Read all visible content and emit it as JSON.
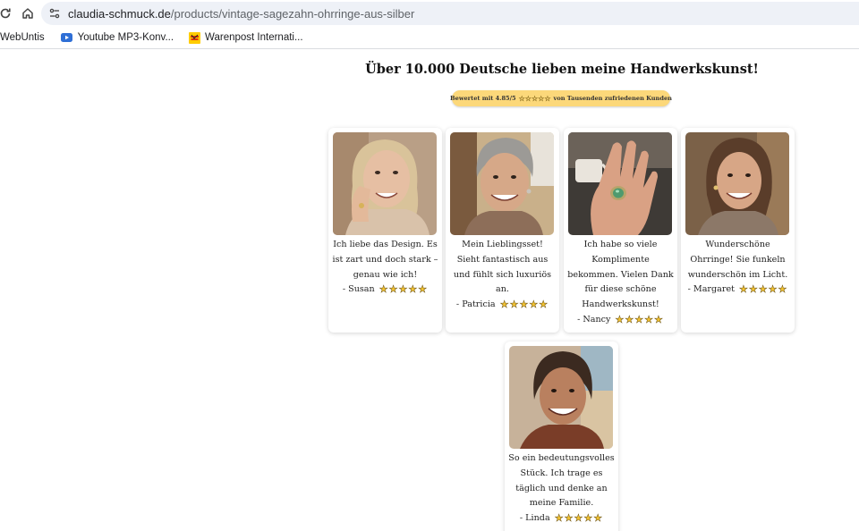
{
  "browser": {
    "url_host": "claudia-schmuck.de",
    "url_path": "/products/vintage-sagezahn-ohrringe-aus-silber",
    "bookmarks": [
      {
        "label": "WebUntis",
        "icon": "webuntis-icon"
      },
      {
        "label": "Youtube MP3-Konv...",
        "icon": "youtube-icon"
      },
      {
        "label": "Warenpost Internati...",
        "icon": "dhl-icon"
      }
    ]
  },
  "page": {
    "headline": "Über 10.000 Deutsche lieben meine Handwerkskunst!",
    "rating": {
      "before": "Bewertet mit 4.85/5",
      "stars": 5,
      "after": "von Tausenden zufriedenen Kunden"
    }
  },
  "testimonials": [
    {
      "quote": "Ich liebe das Design. Es ist zart und doch stark – genau wie ich!",
      "author": "- Susan",
      "stars": 5,
      "photo": "smiling-woman-blonde-hand-on-cheek"
    },
    {
      "quote": "Mein Lieblingsset! Sieht fantastisch aus und fühlt sich luxuriös an.",
      "author": "- Patricia",
      "stars": 5,
      "photo": "smiling-woman-short-gray-hair"
    },
    {
      "quote": "Ich habe so viele Komplimente bekommen. Vielen Dank für diese schöne Handwerkskunst!",
      "author": "- Nancy",
      "stars": 5,
      "photo": "hand-with-green-gemstone-ring"
    },
    {
      "quote": "Wunderschöne Ohrringe! Sie funkeln wunderschön im Licht.",
      "author": "- Margaret",
      "stars": 5,
      "photo": "smiling-woman-brown-hair-earrings"
    },
    {
      "quote": "So ein bedeutungsvolles Stück. Ich trage es täglich und denke an meine Familie.",
      "author": "- Linda",
      "stars": 5,
      "photo": "smiling-woman-beach"
    }
  ],
  "colors": {
    "pill": "#fcd87a",
    "star_fill": "#f2c230",
    "omnibox": "#eef1f7"
  }
}
